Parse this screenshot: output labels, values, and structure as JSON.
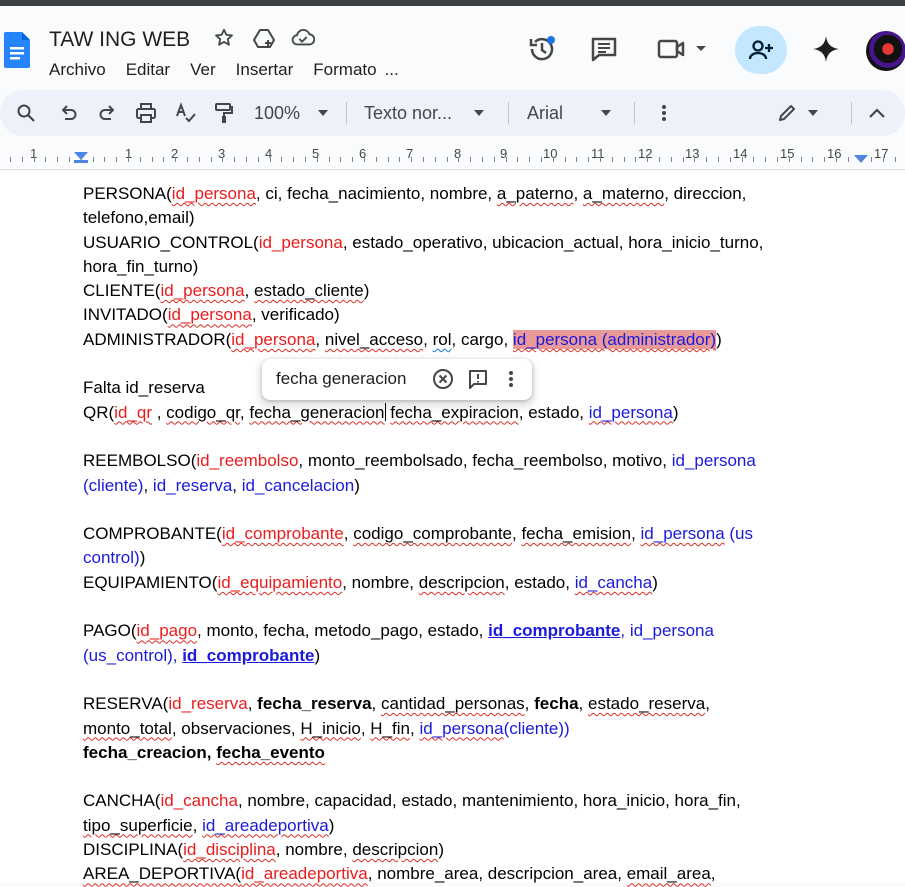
{
  "document": {
    "title": "TAW ING WEB"
  },
  "menu": {
    "items": [
      "Archivo",
      "Editar",
      "Ver",
      "Insertar",
      "Formato",
      "..."
    ]
  },
  "toolbar": {
    "zoom": "100%",
    "style": "Texto nor...",
    "font": "Arial"
  },
  "ruler": {
    "numbers": [
      "1",
      "1",
      "2",
      "3",
      "4",
      "5",
      "6",
      "7",
      "8",
      "9",
      "10",
      "11",
      "12",
      "13",
      "14",
      "15",
      "16",
      "17"
    ]
  },
  "popup": {
    "text": "fecha generacion"
  },
  "content": {
    "persona": {
      "a": "PERSONA(",
      "b": "id_persona",
      "c": ", ci, fecha_nacimiento, nombre, ",
      "d": "a_paterno",
      "e": ", ",
      "f": "a_materno",
      "g": ", direccion,",
      "h": "telefono,email)"
    },
    "usuario": {
      "a": "USUARIO_CONTROL(",
      "b": "id_persona",
      "c": ", estado_operativo, ubicacion_actual, hora_inicio_turno,",
      "d": "hora_fin_turno)"
    },
    "cliente": {
      "a": "CLIENTE(",
      "b": "id_persona",
      "c": ", ",
      "d": "estado_cliente",
      "e": ")"
    },
    "invitado": {
      "a": "INVITADO(",
      "b": "id_persona",
      "c": ", verificado)"
    },
    "admin": {
      "a": "ADMINISTRADOR(",
      "b": "id_persona",
      "c": ", ",
      "d": "nivel_acceso",
      "e": ", ",
      "f": "rol",
      "g": ", cargo, ",
      "h": "id_persona (administrador)",
      "i": ")"
    },
    "falta": "Falta id_reserva",
    "qr": {
      "a": "QR(",
      "b": "id_qr",
      "c": " , ",
      "d": "codigo_qr",
      "e": ", ",
      "f": "fecha_generacion",
      "g": " ",
      "h": "fecha_expiracion",
      "i": ", estado, ",
      "j": "id_persona",
      "k": ")"
    },
    "reembolso": {
      "a": "REEMBOLSO(",
      "b": "id_reembolso",
      "c": ", monto_reembolsado, fecha_reembolso, motivo, ",
      "d": "id_persona",
      "e": "(cliente)",
      "f": ", ",
      "g": "id_reserva",
      "h": ", ",
      "i": "id_cancelacion",
      "j": ")"
    },
    "comprobante": {
      "a": "COMPROBANTE(",
      "b": "id_comprobante",
      "c": ", ",
      "d": "codigo_comprobante",
      "e": ", ",
      "f": "fecha_emision",
      "g": ", ",
      "h": "id_persona",
      "i": " (us",
      "j": "control)",
      "k": ")"
    },
    "equipamiento": {
      "a": "EQUIPAMIENTO(",
      "b": "id_equipamiento",
      "c": ", nombre, ",
      "d": "descripcion",
      "e": ", estado, ",
      "f": "id_cancha",
      "g": ")"
    },
    "pago": {
      "a": "PAGO(",
      "b": "id_pago",
      "c": ", monto, fecha, metodo_pago, estado, ",
      "d": "id_comprobante",
      "e": ", id_persona",
      "f": "(us_control), ",
      "g": "id_comprobante",
      "h": ")"
    },
    "reserva": {
      "a": "RESERVA(",
      "b": "id_reserva",
      "c": ", ",
      "d": "fecha_reserva",
      "e": ", ",
      "f": "cantidad_personas",
      "g": ", ",
      "h": "fecha",
      "i": ", ",
      "j": "estado_reserva",
      "k": ",",
      "l": "monto_total",
      "m": ", observaciones, ",
      "n": "H_inicio",
      "o": ", ",
      "p": "H_fin",
      "q": ", ",
      "r": "id_persona",
      "s": "(cliente))",
      "t": "fecha_creacion, ",
      "u": "fecha_evento"
    },
    "cancha": {
      "a": "CANCHA(",
      "b": "id_cancha",
      "c": ", nombre, capacidad, estado, mantenimiento, hora_inicio, hora_fin,",
      "d": "tipo_superficie",
      "e": ", ",
      "f": "id_areadeportiva",
      "g": ")"
    },
    "disciplina": {
      "a": "DISCIPLINA(",
      "b": "id_disciplina",
      "c": ", nombre, ",
      "d": "descripcion",
      "e": ")"
    },
    "area": {
      "a": "AREA_DEPORTIVA(",
      "b": "id_areadeportiva",
      "c": ", nombre_area, descripcion_area, ",
      "d": "email_area",
      "e": ","
    }
  }
}
